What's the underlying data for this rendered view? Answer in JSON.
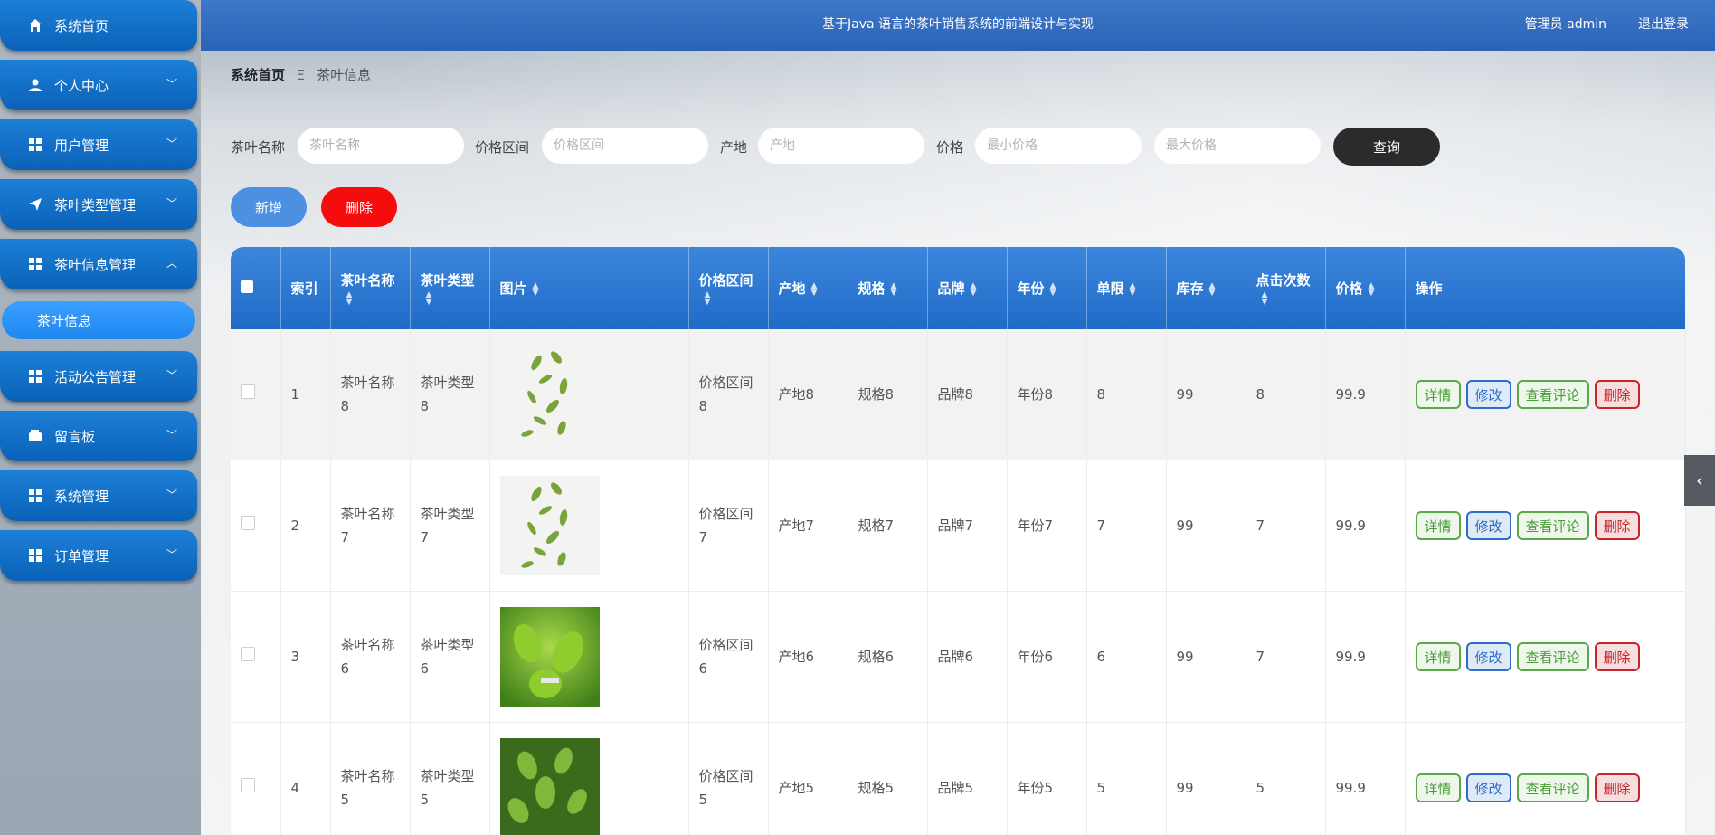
{
  "header": {
    "title": "基于Java 语言的茶叶销售系统的前端设计与实现",
    "user": "管理员 admin",
    "logout": "退出登录"
  },
  "sidebar": {
    "items": [
      {
        "label": "系统首页",
        "icon": "home-icon"
      },
      {
        "label": "个人中心",
        "icon": "user-icon"
      },
      {
        "label": "用户管理",
        "icon": "grid-icon"
      },
      {
        "label": "茶叶类型管理",
        "icon": "send-icon"
      },
      {
        "label": "茶叶信息管理",
        "icon": "grid-icon"
      },
      {
        "label": "活动公告管理",
        "icon": "grid-icon"
      },
      {
        "label": "留言板",
        "icon": "wallet-icon"
      },
      {
        "label": "系统管理",
        "icon": "grid-icon"
      },
      {
        "label": "订单管理",
        "icon": "grid-icon"
      }
    ],
    "submenu": "茶叶信息"
  },
  "breadcrumb": {
    "home": "系统首页",
    "sep": "Ξ",
    "current": "茶叶信息"
  },
  "search": {
    "name_label": "茶叶名称",
    "name_placeholder": "茶叶名称",
    "range_label": "价格区间",
    "range_placeholder": "价格区间",
    "origin_label": "产地",
    "origin_placeholder": "产地",
    "price_label": "价格",
    "min_placeholder": "最小价格",
    "max_placeholder": "最大价格",
    "query": "查询"
  },
  "actions": {
    "add": "新增",
    "delete": "删除"
  },
  "table": {
    "columns": [
      "索引",
      "茶叶名称",
      "茶叶类型",
      "图片",
      "价格区间",
      "产地",
      "规格",
      "品牌",
      "年份",
      "单限",
      "库存",
      "点击次数",
      "价格",
      "操作"
    ],
    "rows": [
      {
        "index": "1",
        "name": "茶叶名称8",
        "type": "茶叶类型8",
        "img": "leaves",
        "range": "价格区间8",
        "origin": "产地8",
        "spec": "规格8",
        "brand": "品牌8",
        "year": "年份8",
        "limit": "8",
        "stock": "99",
        "clicks": "8",
        "price": "99.9"
      },
      {
        "index": "2",
        "name": "茶叶名称7",
        "type": "茶叶类型7",
        "img": "leaves",
        "range": "价格区间7",
        "origin": "产地7",
        "spec": "规格7",
        "brand": "品牌7",
        "year": "年份7",
        "limit": "7",
        "stock": "99",
        "clicks": "7",
        "price": "99.9"
      },
      {
        "index": "3",
        "name": "茶叶名称6",
        "type": "茶叶类型6",
        "img": "bud",
        "range": "价格区间6",
        "origin": "产地6",
        "spec": "规格6",
        "brand": "品牌6",
        "year": "年份6",
        "limit": "6",
        "stock": "99",
        "clicks": "7",
        "price": "99.9"
      },
      {
        "index": "4",
        "name": "茶叶名称5",
        "type": "茶叶类型5",
        "img": "bush",
        "range": "价格区间5",
        "origin": "产地5",
        "spec": "规格5",
        "brand": "品牌5",
        "year": "年份5",
        "limit": "5",
        "stock": "99",
        "clicks": "5",
        "price": "99.9"
      }
    ],
    "ops": {
      "detail": "详情",
      "edit": "修改",
      "review": "查看评论",
      "remove": "删除"
    }
  }
}
